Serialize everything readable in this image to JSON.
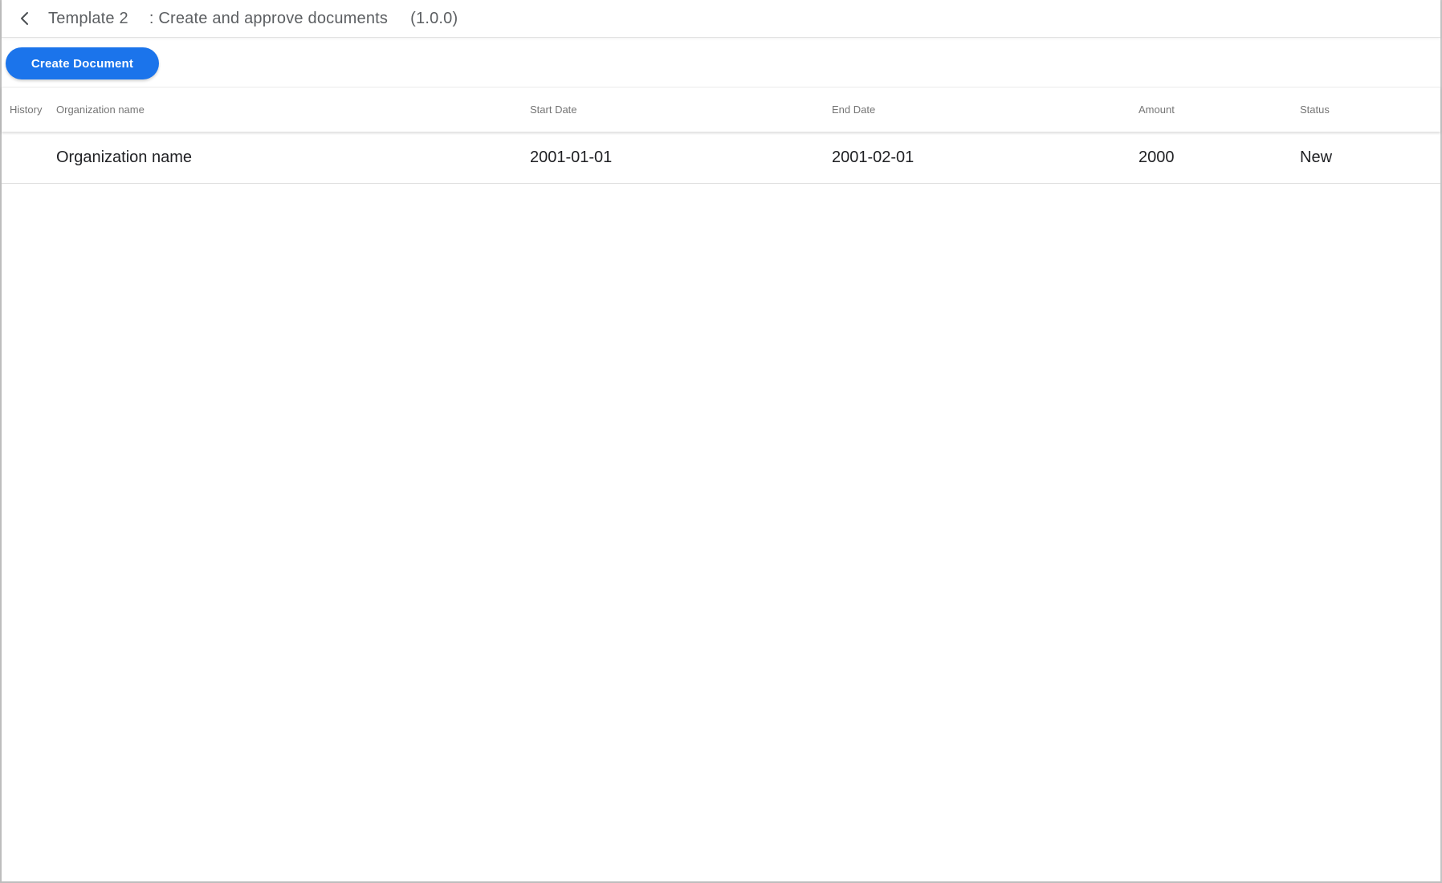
{
  "header": {
    "back_icon": "chevron-left",
    "template_name": "Template 2",
    "template_description": ": Create and approve documents",
    "template_version": "(1.0.0)"
  },
  "toolbar": {
    "create_button_label": "Create Document"
  },
  "table": {
    "columns": [
      "History",
      "Organization name",
      "Start Date",
      "End Date",
      "Amount",
      "Status"
    ],
    "rows": [
      {
        "history": "",
        "organization": "Organization name",
        "start_date": "2001-01-01",
        "end_date": "2001-02-01",
        "amount": "2000",
        "status": "New"
      }
    ]
  },
  "colors": {
    "accent_blue": "#1b74eb",
    "title_gray": "#5c5f62",
    "column_header_gray": "#757575",
    "row_text": "#202124",
    "row_divider": "#e0e0e0"
  }
}
